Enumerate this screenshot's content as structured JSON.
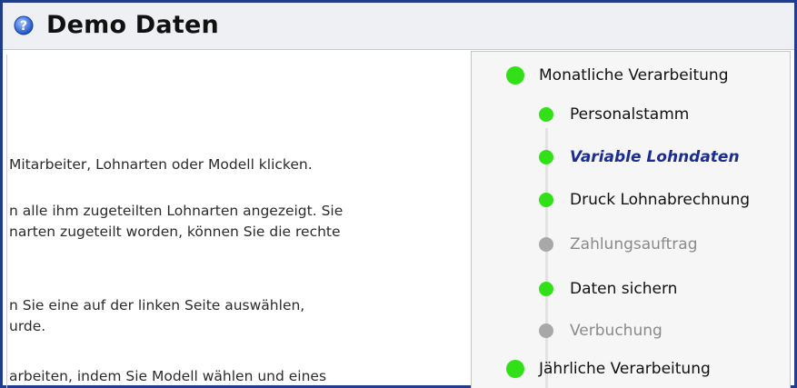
{
  "header": {
    "title": "Demo Daten",
    "help_icon": "help-circle-icon"
  },
  "description": {
    "lines": [
      "Mitarbeiter, Lohnarten oder Modell klicken.",
      "n alle ihm zugeteilten Lohnarten angezeigt. Sie",
      "narten zugeteilt worden, können Sie die rechte",
      "n Sie eine auf der linken Seite auswählen,",
      "urde.",
      "arbeiten, indem Sie Modell wählen und eines"
    ]
  },
  "workflow": {
    "items": [
      {
        "label": "Monatliche Verarbeitung",
        "status": "done",
        "level": 0
      },
      {
        "label": "Personalstamm",
        "status": "done",
        "level": 1
      },
      {
        "label": "Variable Lohndaten",
        "status": "active",
        "level": 1
      },
      {
        "label": "Druck Lohnabrechnung",
        "status": "done",
        "level": 1
      },
      {
        "label": "Zahlungsauftrag",
        "status": "pending",
        "level": 1
      },
      {
        "label": "Daten sichern",
        "status": "done",
        "level": 1
      },
      {
        "label": "Verbuchung",
        "status": "pending",
        "level": 1
      },
      {
        "label": "Jährliche Verarbeitung",
        "status": "done",
        "level": 0
      }
    ]
  },
  "colors": {
    "accent_blue": "#1b2d93",
    "done_green": "#32e018",
    "pending_gray": "#a8a8a8",
    "frame_border": "#1f3d8a"
  }
}
